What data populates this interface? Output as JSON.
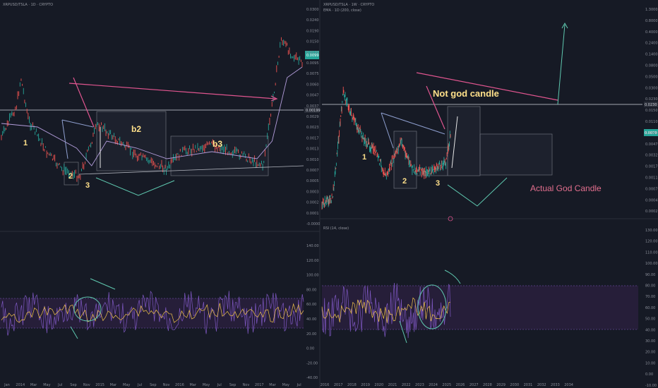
{
  "left_chart": {
    "title": "XRPUSD/TSLA · 1D · CRYPTO",
    "price_ticks": [
      "0.0300",
      "0.0240",
      "0.0190",
      "0.0150",
      "0.0120",
      "0.0095",
      "0.0075",
      "0.0060",
      "0.0047",
      "0.0037",
      "0.0029",
      "0.0023",
      "0.0017",
      "0.0013",
      "0.0010",
      "0.0007",
      "0.0005",
      "0.0003",
      "0.0002",
      "0.0001",
      "-0.0000"
    ],
    "current_price": "0.0099",
    "hline_price": "0.00199",
    "rsi_ticks": [
      "140.00",
      "120.00",
      "100.00",
      "80.00",
      "60.00",
      "40.00",
      "20.00",
      "0.00",
      "-20.00",
      "-40.00"
    ],
    "x_ticks": [
      "Jan",
      "2014",
      "Mar",
      "May",
      "Jul",
      "Sep",
      "Nov",
      "2015",
      "Mar",
      "May",
      "Jul",
      "Sep",
      "Nov",
      "2016",
      "Mar",
      "May",
      "Jul",
      "Sep",
      "Nov",
      "2017",
      "Mar",
      "May",
      "Jul"
    ],
    "labels": {
      "w1": "1",
      "w2": "2",
      "w3": "3",
      "b2": "b2",
      "b3": "b3"
    }
  },
  "right_chart": {
    "title": "XRPUSD/TSLA · 1W · CRYPTO",
    "indicator": "EMA · 1D (200, close)",
    "price_ticks": [
      "1.3000",
      "0.8000",
      "0.4000",
      "0.2400",
      "0.1400",
      "0.0800",
      "0.0500",
      "0.0300",
      "0.0230",
      "0.0150",
      "0.0110",
      "0.0069",
      "0.0047",
      "0.0032",
      "0.0017",
      "0.0011",
      "0.0007",
      "0.0004",
      "0.0002"
    ],
    "current_price": "0.0230",
    "current_price2": "0.0079",
    "rsi_title": "RSI (14, close)",
    "rsi_ticks": [
      "130.00",
      "120.00",
      "110.00",
      "100.00",
      "90.00",
      "80.00",
      "70.00",
      "60.00",
      "50.00",
      "40.00",
      "30.00",
      "20.00",
      "10.00",
      "0.00",
      "-10.00"
    ],
    "x_ticks": [
      "2016",
      "2017",
      "2018",
      "2019",
      "2020",
      "2021",
      "2022",
      "2023",
      "2024",
      "2025",
      "2026",
      "2027",
      "2028",
      "2029",
      "2030",
      "2031",
      "2032",
      "2033",
      "2034"
    ],
    "labels": {
      "w1": "1",
      "w2": "2",
      "w3": "3",
      "not_god": "Not god candle",
      "actual_god": "Actual God Candle"
    }
  },
  "colors": {
    "bg": "#161a25",
    "up": "#26a69a",
    "down": "#ef5350",
    "ema": "#b39ddb",
    "rsi": "#7e57c2",
    "rsi_ma": "#f0c24a",
    "band": "#2a1f3f",
    "pink": "#e0558f",
    "teal": "#5fc9b0",
    "yellow": "#ffe08a"
  }
}
